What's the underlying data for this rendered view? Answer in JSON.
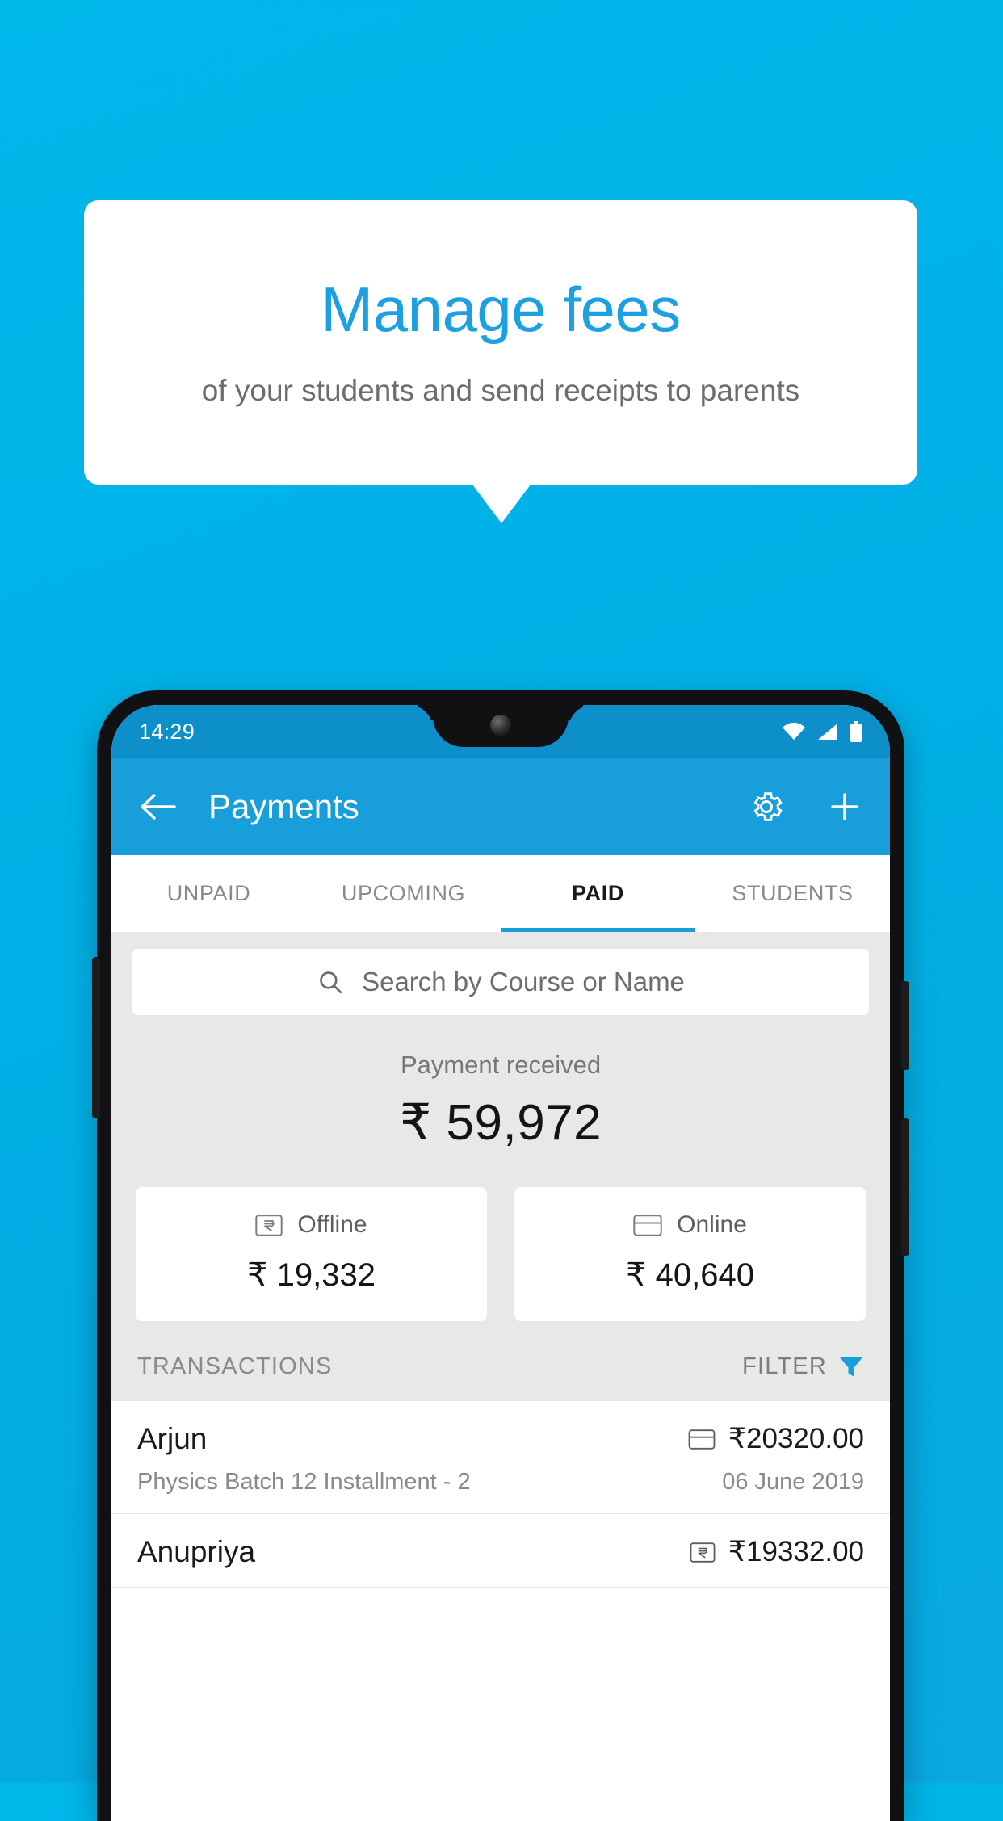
{
  "promo": {
    "title": "Manage fees",
    "subtitle": "of your students and send receipts to parents",
    "background_color": "#00b0e6",
    "title_color": "#1ba1e2"
  },
  "phone": {
    "status_bar": {
      "time": "14:29",
      "icons": [
        "wifi-icon",
        "signal-icon",
        "battery-icon"
      ],
      "background_color": "#0d8fc9"
    },
    "app_bar": {
      "back_icon": "arrow-left-icon",
      "title": "Payments",
      "settings_icon": "gear-icon",
      "add_icon": "plus-icon",
      "background_color": "#189fdb"
    },
    "tabs": [
      {
        "label": "UNPAID",
        "active": false
      },
      {
        "label": "UPCOMING",
        "active": false
      },
      {
        "label": "PAID",
        "active": true
      },
      {
        "label": "STUDENTS",
        "active": false
      }
    ],
    "search": {
      "icon": "search-icon",
      "placeholder": "Search by Course or Name",
      "value": ""
    },
    "summary": {
      "label": "Payment received",
      "amount": "₹ 59,972",
      "breakdown": [
        {
          "icon": "cash-note-icon",
          "label": "Offline",
          "amount": "₹ 19,332"
        },
        {
          "icon": "credit-card-icon",
          "label": "Online",
          "amount": "₹ 40,640"
        }
      ]
    },
    "transactions_header": {
      "title": "TRANSACTIONS",
      "filter_label": "FILTER",
      "filter_icon": "funnel-icon",
      "filter_icon_color": "#189fdb"
    },
    "transactions": [
      {
        "name": "Arjun",
        "method_icon": "credit-card-icon",
        "amount": "₹20320.00",
        "description": "Physics Batch 12 Installment - 2",
        "date": "06 June 2019"
      },
      {
        "name": "Anupriya",
        "method_icon": "cash-note-icon",
        "amount": "₹19332.00",
        "description": "",
        "date": ""
      }
    ]
  }
}
